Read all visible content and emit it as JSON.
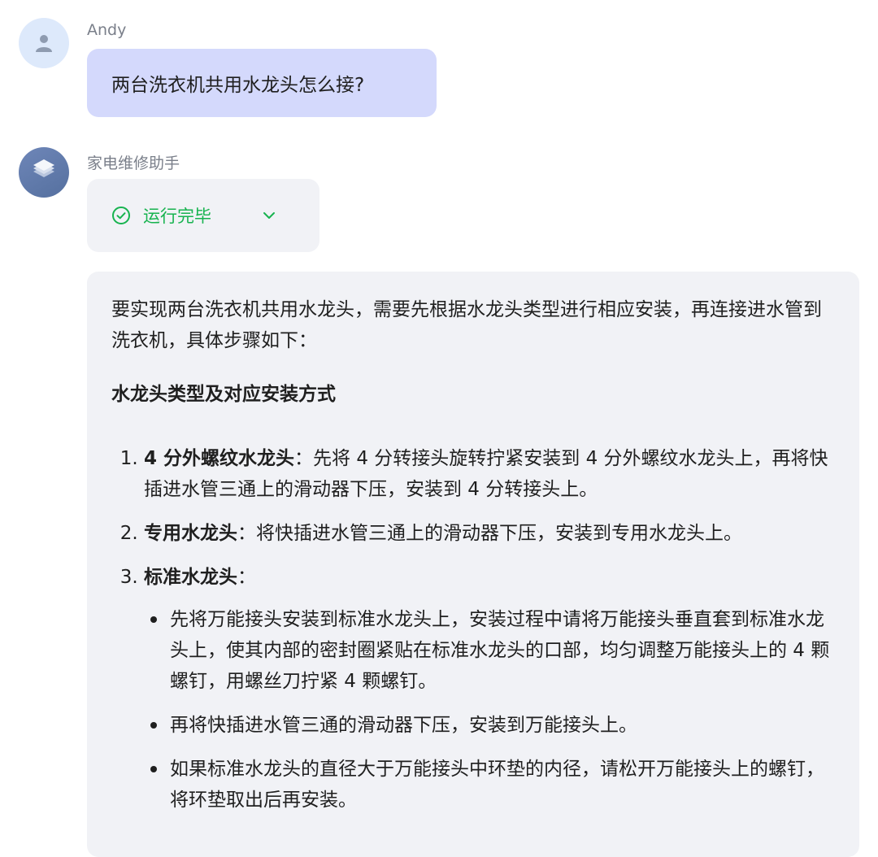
{
  "user": {
    "name": "Andy",
    "message": "两台洗衣机共用水龙头怎么接?"
  },
  "bot": {
    "name": "家电维修助手",
    "status": "运行完毕",
    "status_color": "#17b34f"
  },
  "answer": {
    "intro": "要实现两台洗衣机共用水龙头，需要先根据水龙头类型进行相应安装，再连接进水管到洗衣机，具体步骤如下：",
    "heading": "水龙头类型及对应安装方式",
    "steps": [
      {
        "title": "4 分外螺纹水龙头",
        "sep": "：",
        "text": "先将 4 分转接头旋转拧紧安装到 4 分外螺纹水龙头上，再将快插进水管三通上的滑动器下压，安装到 4 分转接头上。"
      },
      {
        "title": "专用水龙头",
        "sep": "：",
        "text": "将快插进水管三通上的滑动器下压，安装到专用水龙头上。"
      },
      {
        "title": "标准水龙头",
        "sep": "：",
        "text": ""
      }
    ],
    "bullets": [
      "先将万能接头安装到标准水龙头上，安装过程中请将万能接头垂直套到标准水龙头上，使其内部的密封圈紧贴在标准水龙头的口部，均匀调整万能接头上的 4 颗螺钉，用螺丝刀拧紧 4 颗螺钉。",
      "再将快插进水管三通的滑动器下压，安装到万能接头上。",
      "如果标准水龙头的直径大于万能接头中环垫的内径，请松开万能接头上的螺钉，将环垫取出后再安装。"
    ]
  },
  "colors": {
    "user_bubble": "#d4d9fc",
    "card_bg": "#f1f2f6",
    "accent_green": "#17b34f"
  },
  "icons": {
    "user_avatar": "person-icon",
    "bot_avatar": "layers-icon",
    "status": "check-circle-icon",
    "expand": "chevron-down-icon"
  }
}
